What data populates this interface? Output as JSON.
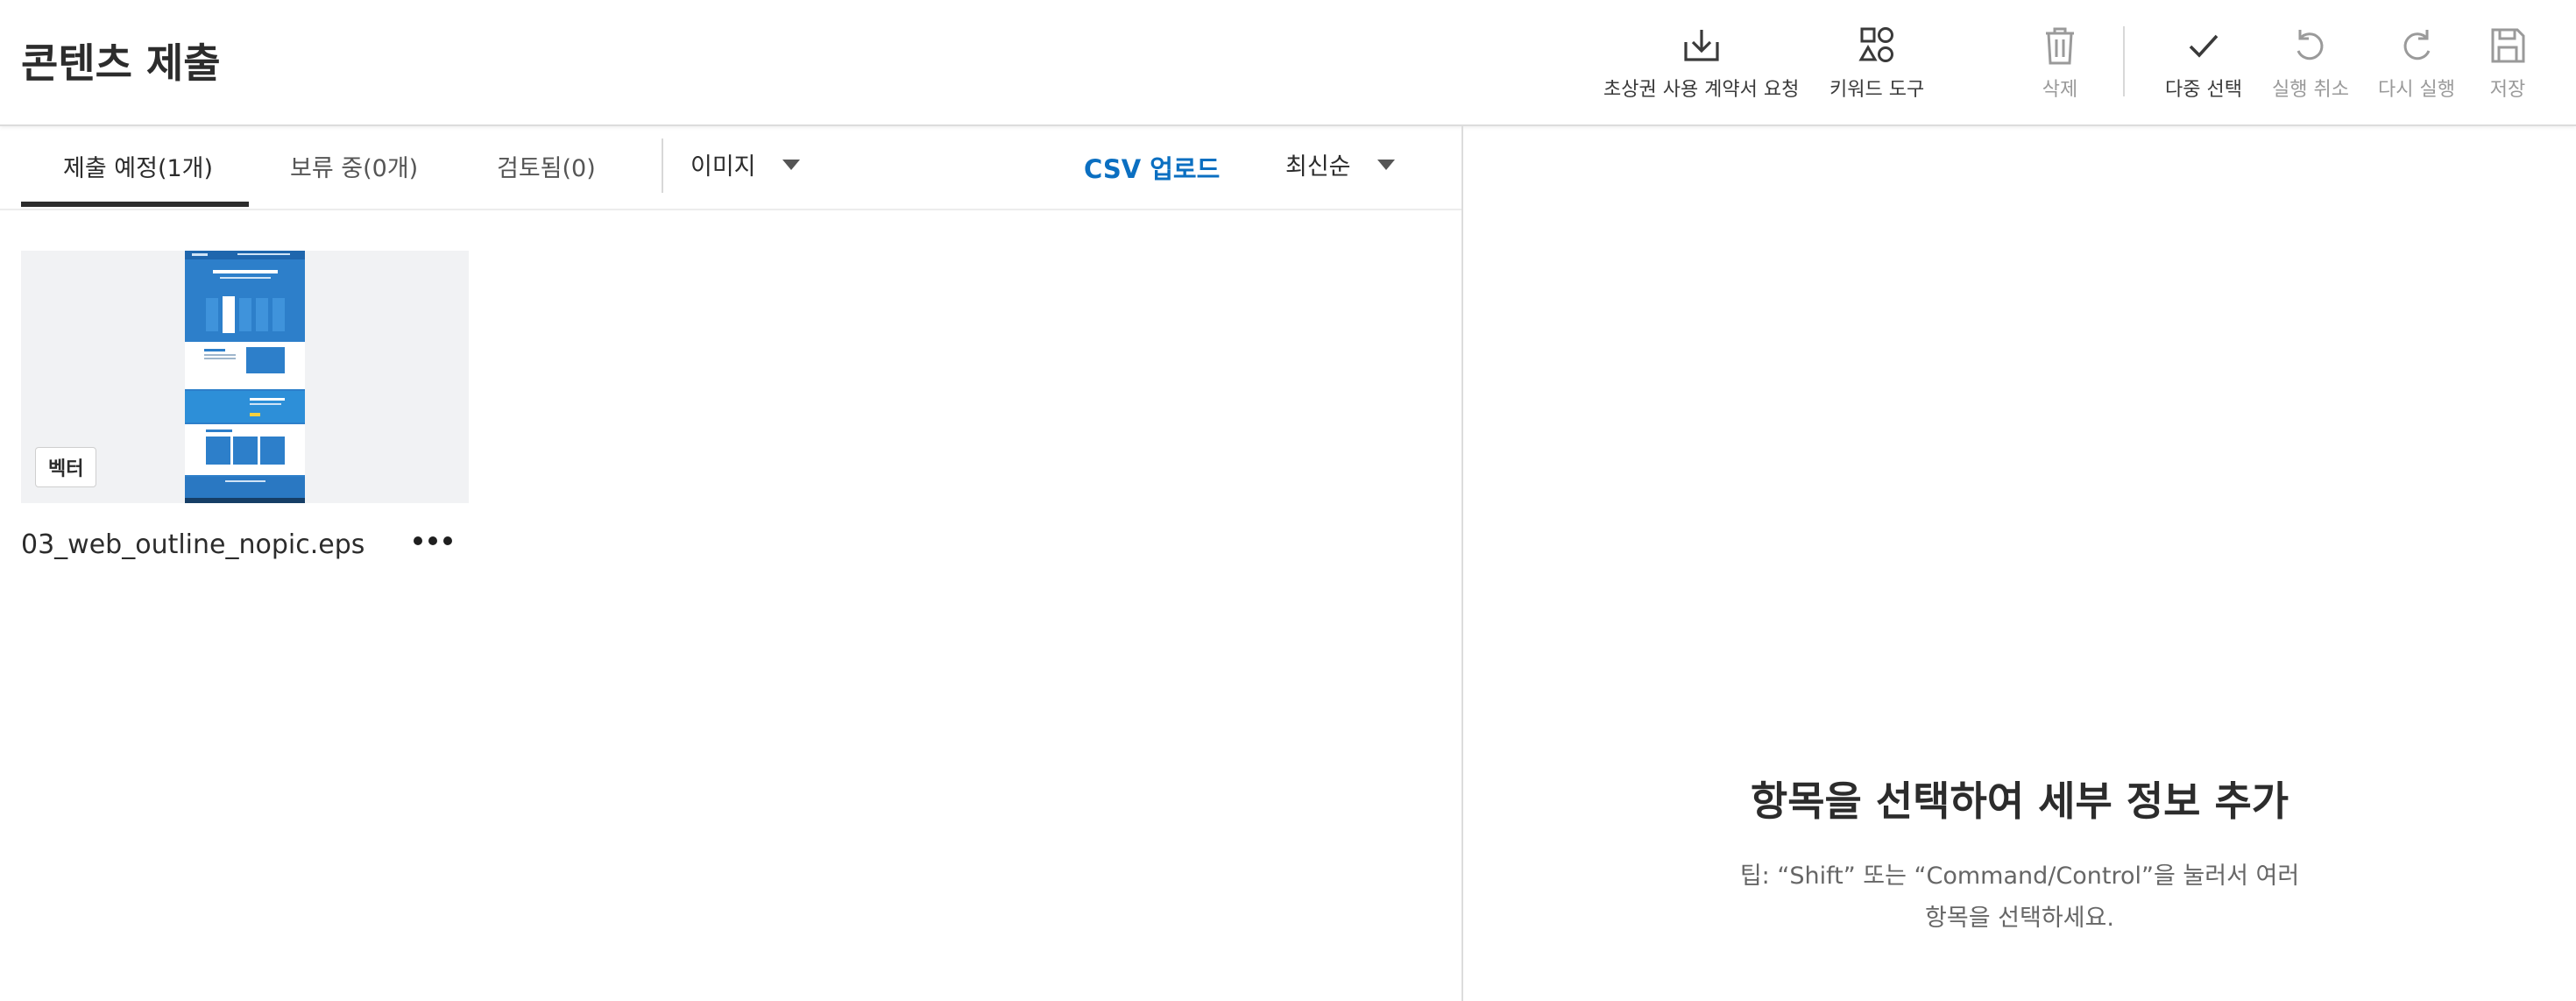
{
  "header": {
    "title": "콘텐츠 제출",
    "tools": {
      "release": "초상권 사용 계약서 요청",
      "keyword": "키워드 도구",
      "delete": "삭제",
      "multi_select": "다중 선택",
      "undo": "실행 취소",
      "redo": "다시 실행",
      "save": "저장"
    }
  },
  "tabs": {
    "to_submit": "제출 예정(1개)",
    "pending": "보류 중(0개)",
    "reviewed": "검토됨(0)"
  },
  "filters": {
    "type": "이미지",
    "csv_upload": "CSV 업로드",
    "sort": "최신순"
  },
  "items": [
    {
      "filename": "03_web_outline_nopic.eps",
      "badge": "벡터"
    }
  ],
  "details": {
    "empty_title": "항목을 선택하여 세부 정보 추가",
    "tip": "팁: “Shift” 또는 “Command/Control”을 눌러서 여러 항목을 선택하세요."
  },
  "colors": {
    "accent": "#0b6fc1",
    "text": "#2c2c2c",
    "disabled": "#9a9a9a",
    "thumb_bg": "#f1f2f4"
  },
  "icons": [
    "download-icon",
    "shapes-icon",
    "trash-icon",
    "check-icon",
    "undo-icon",
    "redo-icon",
    "save-icon",
    "chevron-down-icon",
    "more-icon"
  ]
}
